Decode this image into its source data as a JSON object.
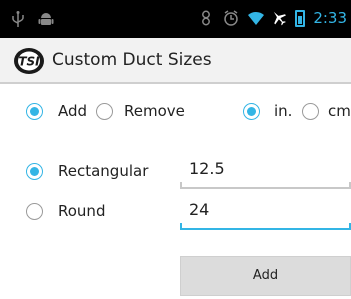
{
  "status_bar": {
    "time": "2:33",
    "icons": [
      "usb-icon",
      "android-debug-icon",
      "sync-icon",
      "alarm-icon",
      "wifi-icon",
      "airplane-icon",
      "battery-icon"
    ]
  },
  "action_bar": {
    "app_icon": "tsi-logo-icon",
    "logo_text": "TSI",
    "title": "Custom Duct Sizes"
  },
  "mode": {
    "options": [
      {
        "label": "Add",
        "checked": true
      },
      {
        "label": "Remove",
        "checked": false
      }
    ]
  },
  "units": {
    "options": [
      {
        "label": "in.",
        "checked": true
      },
      {
        "label": "cm",
        "checked": false
      }
    ]
  },
  "shape": {
    "options": [
      {
        "label": "Rectangular",
        "checked": true,
        "value": "12.5"
      },
      {
        "label": "Round",
        "checked": false,
        "value": "24"
      }
    ]
  },
  "add_button": {
    "label": "Add"
  },
  "colors": {
    "accent": "#33b5e5",
    "status_bar": "#000000",
    "action_bar": "#f2f2f2",
    "button": "#dcdcdc"
  }
}
